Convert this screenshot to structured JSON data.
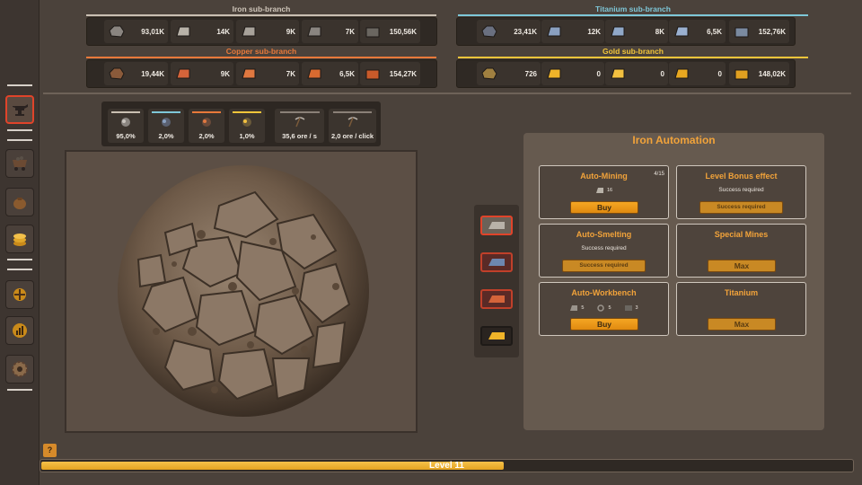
{
  "colors": {
    "iron_line": "#c9bfb2",
    "titanium_line": "#7ec7d8",
    "copper_line": "#e8793a",
    "gold_line": "#f2c53a",
    "accent_orange": "#f2a33a",
    "active_red": "#e0442a"
  },
  "sidebar": {
    "items": [
      {
        "icon": "anvil-icon",
        "active": true
      },
      {
        "icon": "mine-cart-icon",
        "active": false
      },
      {
        "icon": "ore-bag-icon",
        "active": false
      },
      {
        "icon": "coin-stack-icon",
        "active": false
      },
      {
        "icon": "research-icon",
        "active": false
      },
      {
        "icon": "stats-chart-icon",
        "active": false
      },
      {
        "icon": "settings-gear-icon",
        "active": false
      }
    ]
  },
  "branches": {
    "iron": {
      "title": "Iron sub-branch",
      "items": [
        {
          "icon": "iron-ore-icon",
          "value": "93,01K"
        },
        {
          "icon": "iron-ingot-icon",
          "value": "14K"
        },
        {
          "icon": "iron-plate-icon",
          "value": "9K"
        },
        {
          "icon": "iron-gear-icon",
          "value": "7K"
        },
        {
          "icon": "iron-crate-icon",
          "value": "150,56K"
        }
      ]
    },
    "titanium": {
      "title": "Titanium sub-branch",
      "items": [
        {
          "icon": "titanium-ore-icon",
          "value": "23,41K"
        },
        {
          "icon": "titanium-ingot-icon",
          "value": "12K"
        },
        {
          "icon": "titanium-plate-icon",
          "value": "8K"
        },
        {
          "icon": "titanium-wrench-icon",
          "value": "6,5K"
        },
        {
          "icon": "titanium-crate-icon",
          "value": "152,76K"
        }
      ]
    },
    "copper": {
      "title": "Copper sub-branch",
      "items": [
        {
          "icon": "copper-ore-icon",
          "value": "19,44K"
        },
        {
          "icon": "copper-ingot-icon",
          "value": "9K"
        },
        {
          "icon": "copper-wire-icon",
          "value": "7K"
        },
        {
          "icon": "copper-coil-icon",
          "value": "6,5K"
        },
        {
          "icon": "copper-crate-icon",
          "value": "154,27K"
        }
      ]
    },
    "gold": {
      "title": "Gold sub-branch",
      "items": [
        {
          "icon": "gold-ore-icon",
          "value": "726"
        },
        {
          "icon": "gold-ingot-icon",
          "value": "0"
        },
        {
          "icon": "gold-bar-icon",
          "value": "0"
        },
        {
          "icon": "gold-key-icon",
          "value": "0"
        },
        {
          "icon": "gold-chest-icon",
          "value": "148,02K"
        }
      ]
    }
  },
  "stats": {
    "chances": [
      {
        "icon": "iron-ore-icon",
        "value": "95,0%",
        "color": "#c9bfb2"
      },
      {
        "icon": "titanium-ore-icon",
        "value": "2,0%",
        "color": "#7ec7d8"
      },
      {
        "icon": "copper-ore-icon",
        "value": "2,0%",
        "color": "#e8793a"
      },
      {
        "icon": "gold-ore-icon",
        "value": "1,0%",
        "color": "#f2c53a"
      }
    ],
    "rates": [
      {
        "icon": "pickaxe-icon",
        "value": "35,6 ore / s"
      },
      {
        "icon": "pickaxe-icon",
        "value": "2,0 ore / click"
      }
    ]
  },
  "ingot_selector": [
    {
      "icon": "iron-ingot-icon",
      "color": "#b8b2a8"
    },
    {
      "icon": "titanium-ingot-icon",
      "color": "#6d87b0"
    },
    {
      "icon": "copper-ingot-icon",
      "color": "#d4643a"
    },
    {
      "icon": "gold-ingot-icon",
      "color": "#f0b429"
    }
  ],
  "automation": {
    "title": "Iron Automation",
    "cards": {
      "auto_mining": {
        "title": "Auto-Mining",
        "count": "4/15",
        "cost": "16",
        "button": "Buy"
      },
      "level_bonus": {
        "title": "Level Bonus effect",
        "sub": "Success required",
        "button": "Success required"
      },
      "auto_smelting": {
        "title": "Auto-Smelting",
        "sub": "Success required",
        "button": "Success required"
      },
      "special_mines": {
        "title": "Special Mines",
        "button": "Max"
      },
      "auto_workbench": {
        "title": "Auto-Workbench",
        "costs": [
          "5",
          "5",
          "3"
        ],
        "button": "Buy"
      },
      "titanium": {
        "title": "Titanium",
        "button": "Max"
      }
    }
  },
  "help": {
    "label": "?"
  },
  "level": {
    "label": "Level 11",
    "progress": 0.57
  }
}
